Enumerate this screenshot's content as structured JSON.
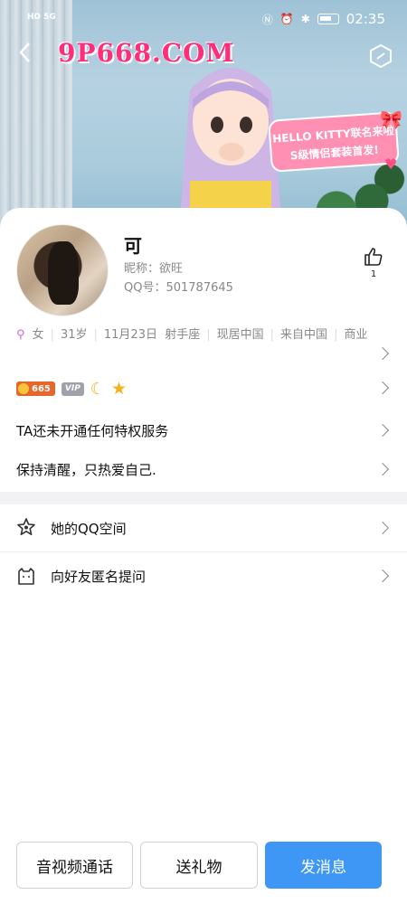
{
  "status_bar": {
    "left_text": "HD 5G",
    "time": "02:35"
  },
  "header": {
    "watermark": "9P668.COM",
    "back_icon": "chevron-left-icon",
    "settings_icon": "hexagon-slash-icon",
    "banner_badge": [
      "HELLO KITTY联名来啦",
      "S级情侣套装首发!"
    ]
  },
  "profile": {
    "name": "可",
    "nickname": "昵称：欲旺",
    "qq": "QQ号：501787645",
    "like_count": "1",
    "info": {
      "gender": "女",
      "age": "31岁",
      "birthday": "11月23日",
      "zodiac": "射手座",
      "location": "现居中国",
      "hometown": "来自中国",
      "occupation": "商业"
    },
    "badges": {
      "coin_value": "665",
      "vip": "VIP"
    },
    "privilege_text": "TA还未开通任何特权服务",
    "signature": "保持清醒，只热爱自己."
  },
  "menu": [
    {
      "label": "她的QQ空间",
      "icon": "star-outline-icon"
    },
    {
      "label": "向好友匿名提问",
      "icon": "cat-question-icon"
    }
  ],
  "actions": {
    "call": "音视频通话",
    "gift": "送礼物",
    "message": "发消息"
  },
  "colors": {
    "primary": "#3f97f5",
    "banner_pink": "#ff8fb3",
    "watermark_pink": "#ff2d7a"
  }
}
